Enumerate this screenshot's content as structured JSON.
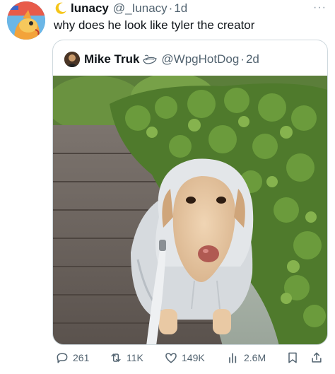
{
  "author": {
    "display_name": "lunacy",
    "handle": "@_Iunacy",
    "separator": "·",
    "time": "1d"
  },
  "tweet": {
    "text": "why does he look like tyler the creator"
  },
  "more_icon": "more-horizontal-icon",
  "quote": {
    "display_name": "Mike Truk",
    "handle": "@WpgHotDog",
    "separator": "·",
    "time": "2d",
    "badge_icon": "hotdog-sketch-icon"
  },
  "actions": {
    "replies": "261",
    "retweets": "11K",
    "likes": "149K",
    "views": "2.6M"
  },
  "icons": {
    "reply": "reply-icon",
    "retweet": "retweet-icon",
    "like": "heart-icon",
    "views": "views-bar-chart-icon",
    "bookmark": "bookmark-icon",
    "share": "share-icon"
  },
  "colors": {
    "text": "#0f1419",
    "secondary": "#536471",
    "border": "#cfd9de"
  }
}
